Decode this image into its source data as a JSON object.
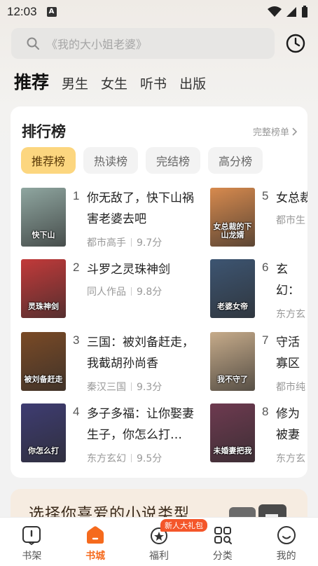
{
  "status_bar": {
    "time": "12:03",
    "notification_glyph": "A"
  },
  "search": {
    "placeholder": "《我的大小姐老婆》"
  },
  "channel_tabs": [
    "推荐",
    "男生",
    "女生",
    "听书",
    "出版"
  ],
  "ranking": {
    "title": "排行榜",
    "more_label": "完整榜单",
    "chips": [
      "推荐榜",
      "热读榜",
      "完结榜",
      "高分榜"
    ],
    "books": [
      {
        "rank": "1",
        "title": "你无敌了，快下山祸害老婆去吧",
        "category": "都市高手",
        "score": "9.7分",
        "cover_text": "快下山",
        "cover_color": "#8fa6a0"
      },
      {
        "rank": "2",
        "title": "斗罗之灵珠神剑",
        "category": "同人作品",
        "score": "9.8分",
        "cover_text": "灵珠神剑",
        "cover_color": "#c23a3a"
      },
      {
        "rank": "3",
        "title": "三国：被刘备赶走，我截胡孙尚香",
        "category": "秦汉三国",
        "score": "9.3分",
        "cover_text": "被刘备赶走",
        "cover_color": "#7a4a26"
      },
      {
        "rank": "4",
        "title": "多子多福：让你娶妻生子，你怎么打…",
        "category": "东方玄幻",
        "score": "9.5分",
        "cover_text": "你怎么打",
        "cover_color": "#3e3c72"
      },
      {
        "rank": "5",
        "title": "女总裁",
        "category": "都市生",
        "score": "",
        "cover_text": "女总裁的下山龙婿",
        "cover_color": "#d78a4e"
      },
      {
        "rank": "6",
        "title": "玄幻：萌娃大",
        "category": "东方玄",
        "score": "",
        "cover_text": "老婆女帝",
        "cover_color": "#3d5572"
      },
      {
        "rank": "7",
        "title": "守活寡区离婚",
        "category": "都市纯",
        "score": "",
        "cover_text": "我不守了",
        "cover_color": "#c6ab8a"
      },
      {
        "rank": "8",
        "title": "修为被妻把我",
        "category": "东方玄",
        "score": "",
        "cover_text": "未婚妻把我",
        "cover_color": "#6e3a50"
      }
    ]
  },
  "genre_banner": {
    "text": "选择你喜爱的小说类型"
  },
  "bottom_nav": {
    "items": [
      "书架",
      "书城",
      "福利",
      "分类",
      "我的"
    ],
    "badge": "新人大礼包",
    "accent": "#f56a1d"
  }
}
